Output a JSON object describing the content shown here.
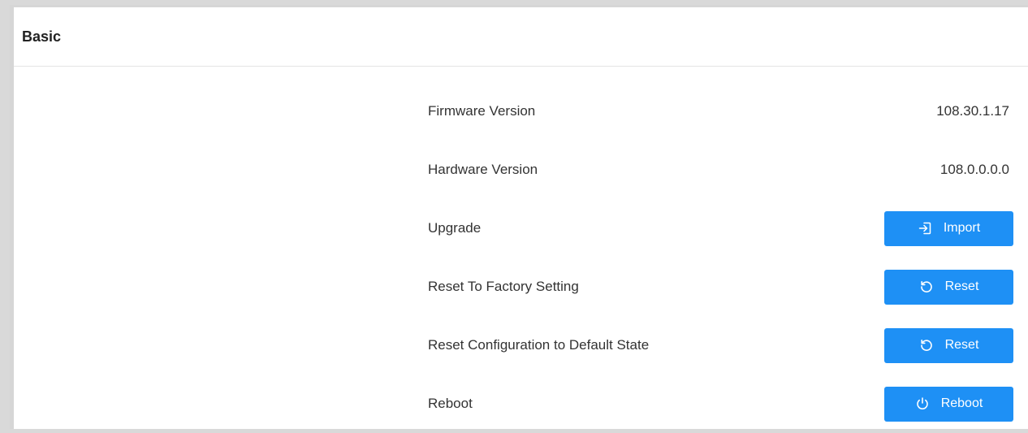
{
  "panel": {
    "title": "Basic"
  },
  "rows": [
    {
      "label": "Firmware Version",
      "value": "108.30.1.17"
    },
    {
      "label": "Hardware Version",
      "value": "108.0.0.0.0"
    },
    {
      "label": "Upgrade",
      "button": {
        "label": "Import",
        "icon": "import-icon"
      }
    },
    {
      "label": "Reset To Factory Setting",
      "button": {
        "label": "Reset",
        "icon": "reset-icon"
      }
    },
    {
      "label": "Reset Configuration to Default State",
      "button": {
        "label": "Reset",
        "icon": "reset-icon"
      }
    },
    {
      "label": "Reboot",
      "button": {
        "label": "Reboot",
        "icon": "power-icon"
      }
    }
  ],
  "colors": {
    "button_bg": "#1e90f5",
    "button_text": "#ffffff",
    "text": "#333333",
    "divider": "#e4e4e4"
  }
}
